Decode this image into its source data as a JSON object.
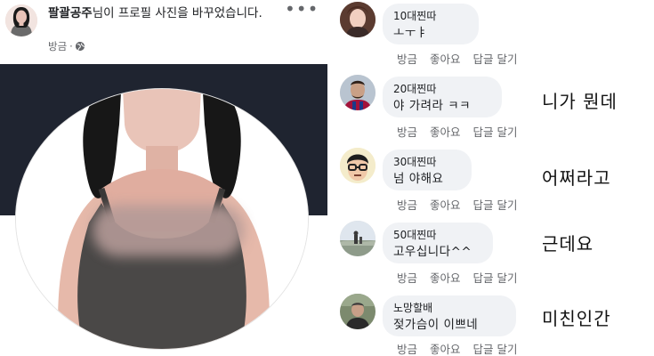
{
  "post": {
    "author": "팔괄공주",
    "action_text": "님이 프로필 사진을 바꾸었습니다.",
    "time": "방금",
    "privacy_icon": "globe-icon",
    "menu_icon": "more-horizontal-icon",
    "more_glyph": "•••"
  },
  "comments": [
    {
      "author": "10대찐따",
      "text": "ㅗㅜㅑ",
      "actions": {
        "time": "방금",
        "like": "좋아요",
        "reply": "답글 달기"
      },
      "caption": ""
    },
    {
      "author": "20대찐따",
      "text": "야 가려라 ㅋㅋ",
      "actions": {
        "time": "방금",
        "like": "좋아요",
        "reply": "답글 달기"
      },
      "caption": "니가  뭔데"
    },
    {
      "author": "30대찐따",
      "text": "넘 야해요",
      "actions": {
        "time": "방금",
        "like": "좋아요",
        "reply": "답글 달기"
      },
      "caption": "어쩌라고"
    },
    {
      "author": "50대찐따",
      "text": "고우십니다^^",
      "actions": {
        "time": "방금",
        "like": "좋아요",
        "reply": "답글 달기"
      },
      "caption": "근데요"
    },
    {
      "author": "노망할배",
      "text": "젖가슴이 이쁘네",
      "actions": {
        "time": "방금",
        "like": "좋아요",
        "reply": "답글 달기"
      },
      "caption": "미친인간"
    }
  ],
  "colors": {
    "cover": "#1f2430",
    "bubble": "#f0f2f5",
    "meta_text": "#65676b"
  }
}
